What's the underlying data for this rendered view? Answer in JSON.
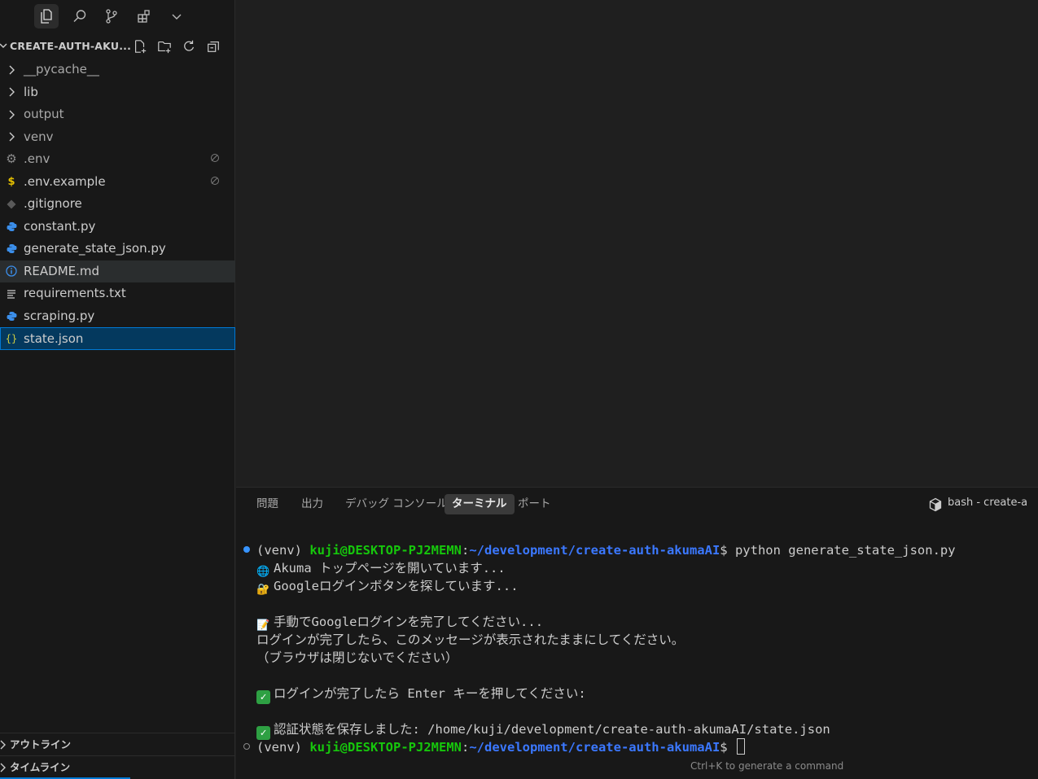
{
  "activity_bar": {
    "icons": [
      "explorer-icon",
      "search-icon",
      "source-control-icon",
      "extensions-icon",
      "chevron-down-icon"
    ]
  },
  "explorer": {
    "title": "CREATE-AUTH-AKU...",
    "actions": [
      "new-file-icon",
      "new-folder-icon",
      "refresh-icon",
      "collapse-all-icon"
    ],
    "items": [
      {
        "label": "__pycache__",
        "type": "folder"
      },
      {
        "label": "lib",
        "type": "folder"
      },
      {
        "label": "output",
        "type": "folder"
      },
      {
        "label": "venv",
        "type": "folder"
      },
      {
        "label": ".env",
        "type": "settings-file"
      },
      {
        "label": ".env.example",
        "type": "env-file"
      },
      {
        "label": ".gitignore",
        "type": "git-file"
      },
      {
        "label": "constant.py",
        "type": "python-file"
      },
      {
        "label": "generate_state_json.py",
        "type": "python-file"
      },
      {
        "label": "README.md",
        "type": "info-file"
      },
      {
        "label": "requirements.txt",
        "type": "text-file"
      },
      {
        "label": "scraping.py",
        "type": "python-file"
      },
      {
        "label": "state.json",
        "type": "json-file"
      }
    ],
    "outline_label": "アウトライン",
    "timeline_label": "タイムライン"
  },
  "panel": {
    "tabs": [
      "問題",
      "出力",
      "デバッグ コンソール",
      "ターミナル",
      "ポート"
    ],
    "active_tab": "ターミナル",
    "terminal_name": "bash - create-a"
  },
  "terminal": {
    "venv": "(venv)",
    "user_host": "kuji@DESKTOP-PJ2MEMN",
    "colon": ":",
    "path": "~/development/create-auth-akumaAI",
    "prompt_char": "$",
    "command": " python generate_state_json.py",
    "lines": {
      "l1": "Akuma トップページを開いています...",
      "l2": "Googleログインボタンを探しています...",
      "l3": "手動でGoogleログインを完了してください...",
      "l4": "ログインが完了したら、このメッセージが表示されたままにしてください。",
      "l5": "（ブラウザは閉じないでください）",
      "l6": "ログインが完了したら Enter キーを押してください:",
      "l7": "認証状態を保存しました: /home/kuji/development/create-auth-akumaAI/state.json"
    },
    "hint": "Ctrl+K to generate a command"
  },
  "colors": {
    "accent": "#0078d4",
    "user_green": "#16c60c",
    "path_blue": "#3b78ff",
    "python_blue": "#3b8eea",
    "check_green": "#2ea043"
  }
}
